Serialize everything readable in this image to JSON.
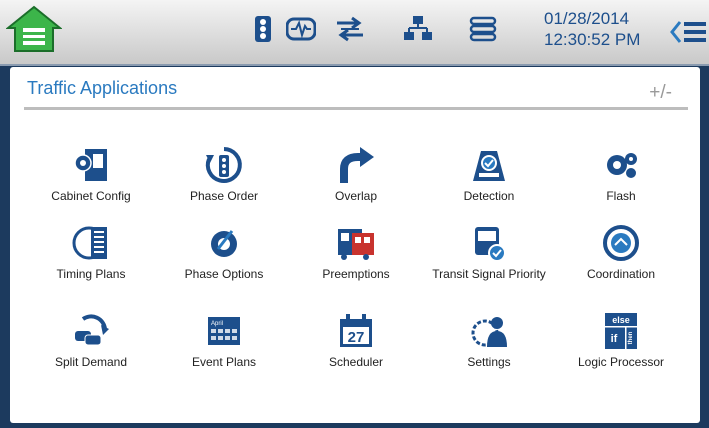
{
  "topbar": {
    "date": "01/28/2014",
    "time": "12:30:52 PM",
    "icons": [
      "signal-head-icon",
      "waveform-icon",
      "swap-arrows-icon",
      "network-icon",
      "server-list-icon"
    ]
  },
  "panel": {
    "title": "Traffic Applications",
    "zoom_toggle": "+/-"
  },
  "apps": [
    {
      "label": "Cabinet Config",
      "icon": "cabinet-gear-icon"
    },
    {
      "label": "Phase Order",
      "icon": "phase-order-icon"
    },
    {
      "label": "Overlap",
      "icon": "overlap-arrow-icon"
    },
    {
      "label": "Detection",
      "icon": "detection-icon"
    },
    {
      "label": "Flash",
      "icon": "flash-gears-icon"
    },
    {
      "label": "Timing Plans",
      "icon": "timing-plans-icon"
    },
    {
      "label": "Phase Options",
      "icon": "phase-options-icon"
    },
    {
      "label": "Preemptions",
      "icon": "preemption-vehicles-icon"
    },
    {
      "label": "Transit Signal Priority",
      "icon": "transit-bus-icon"
    },
    {
      "label": "Coordination",
      "icon": "coordination-icon"
    },
    {
      "label": "Split Demand",
      "icon": "split-demand-icon"
    },
    {
      "label": "Event Plans",
      "icon": "event-calendar-icon"
    },
    {
      "label": "Scheduler",
      "icon": "scheduler-calendar-icon"
    },
    {
      "label": "Settings",
      "icon": "settings-person-icon"
    },
    {
      "label": "Logic Processor",
      "icon": "logic-processor-icon"
    }
  ],
  "logic_icon_text": {
    "top": "else",
    "mid": "if",
    "right": "then"
  },
  "calendar_text": {
    "month": "April",
    "day": "27"
  },
  "colors": {
    "accent": "#2a7ac0",
    "icon": "#1d4f8c",
    "home": "#3cb54a"
  }
}
